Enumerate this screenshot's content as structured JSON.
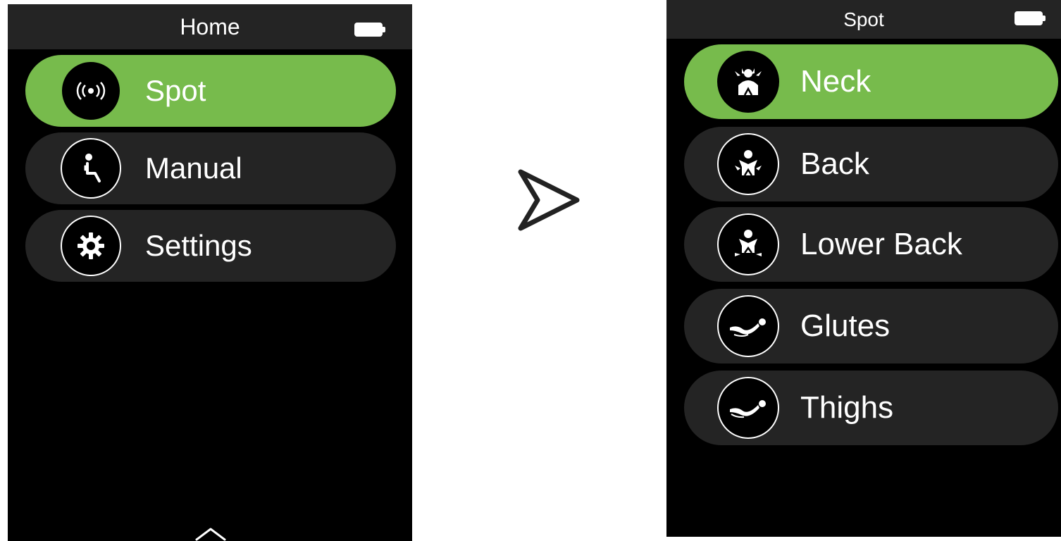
{
  "home_screen": {
    "title": "Home",
    "items": [
      {
        "label": "Spot",
        "icon": "spot-icon",
        "active": true
      },
      {
        "label": "Manual",
        "icon": "manual-icon",
        "active": false
      },
      {
        "label": "Settings",
        "icon": "settings-gear-icon",
        "active": false
      }
    ]
  },
  "spot_screen": {
    "title": "Spot",
    "items": [
      {
        "label": "Neck",
        "icon": "neck-icon",
        "active": true
      },
      {
        "label": "Back",
        "icon": "back-icon",
        "active": false
      },
      {
        "label": "Lower Back",
        "icon": "lower-back-icon",
        "active": false
      },
      {
        "label": "Glutes",
        "icon": "glutes-icon",
        "active": false
      },
      {
        "label": "Thighs",
        "icon": "thighs-icon",
        "active": false
      }
    ]
  },
  "colors": {
    "accent": "#77bb4c",
    "item_background": "#242424",
    "screen_background": "#000000"
  }
}
